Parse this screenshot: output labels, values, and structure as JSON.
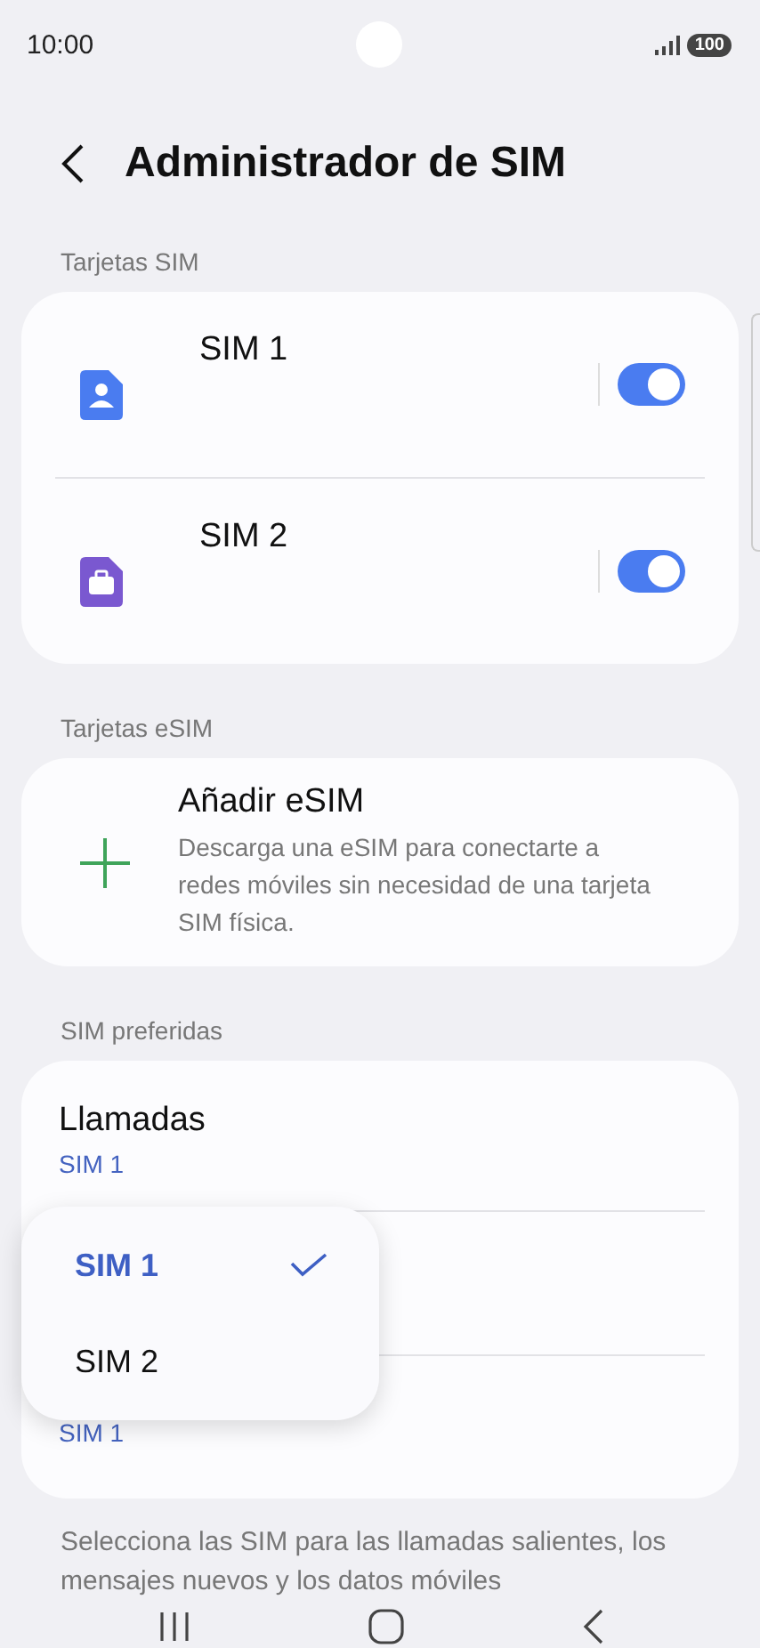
{
  "status_bar": {
    "time": "10:00",
    "battery": "100"
  },
  "header": {
    "title": "Administrador de SIM"
  },
  "sim_section": {
    "label": "Tarjetas SIM",
    "cards": [
      {
        "name": "SIM 1",
        "color": "#4a7cf0",
        "kind": "person",
        "on": true
      },
      {
        "name": "SIM 2",
        "color": "#7a58d0",
        "kind": "work",
        "on": true
      }
    ]
  },
  "esim_section": {
    "label": "Tarjetas eSIM",
    "title": "Añadir eSIM",
    "description": "Descarga una eSIM para conectarte a redes móviles sin necesidad de una tarjeta SIM física."
  },
  "preferred_section": {
    "label": "SIM preferidas",
    "rows": [
      {
        "kind": "item",
        "title": "Llamadas",
        "value": "SIM 1"
      },
      {
        "kind": "covered"
      },
      {
        "kind": "item",
        "value": "SIM 1"
      }
    ]
  },
  "popup": {
    "options": [
      {
        "label": "SIM 1",
        "selected": true
      },
      {
        "label": "SIM 2",
        "selected": false
      }
    ]
  },
  "footer": "Selecciona las SIM para las llamadas salientes, los mensajes nuevos y los datos móviles"
}
